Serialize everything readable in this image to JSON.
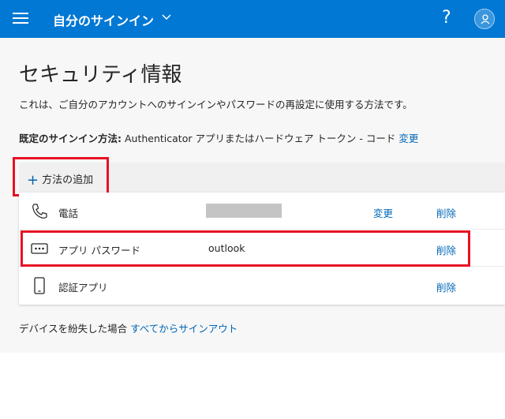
{
  "header": {
    "title": "自分のサインイン",
    "menu_icon": "hamburger-icon",
    "chevron_icon": "chevron-down-icon",
    "help_label": "?",
    "avatar_icon": "user-icon",
    "color": "#0078d4"
  },
  "page": {
    "title": "セキュリティ情報",
    "description": "これは、ご自分のアカウントへのサインインやパスワードの再設定に使用する方法です。",
    "default_method_label": "既定のサインイン方法:",
    "default_method_value": "Authenticator アプリまたはハードウェア トークン - コード",
    "default_method_change": "変更"
  },
  "add_method": {
    "label": "方法の追加",
    "icon": "plus-icon"
  },
  "methods": [
    {
      "name": "電話",
      "icon": "phone-icon",
      "detail": "",
      "redacted": true,
      "change": "変更",
      "delete": "削除"
    },
    {
      "name": "アプリ パスワード",
      "icon": "app-password-icon",
      "detail": "outlook",
      "redacted": false,
      "change": "",
      "delete": "削除"
    },
    {
      "name": "認証アプリ",
      "icon": "mobile-device-icon",
      "detail": "",
      "redacted": false,
      "change": "",
      "delete": "削除"
    }
  ],
  "footer": {
    "lost_device_text": "デバイスを紛失した場合",
    "sign_out_link": "すべてからサインアウト"
  },
  "colors": {
    "link": "#0067b8",
    "highlight": "#e81123",
    "background": "#f7f7f7"
  }
}
